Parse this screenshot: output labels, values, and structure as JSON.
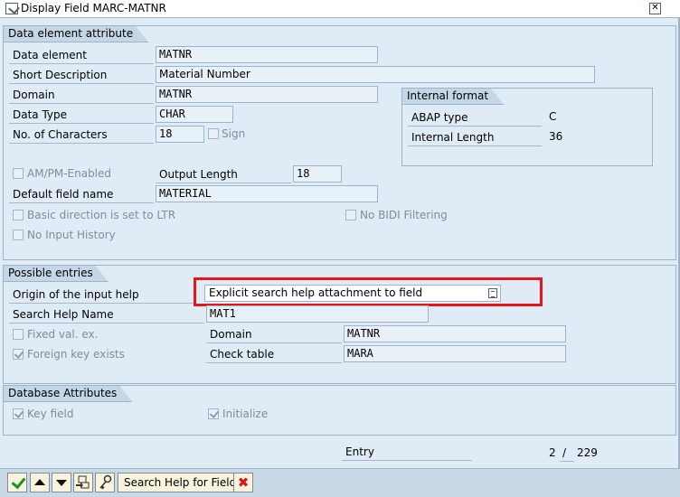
{
  "window": {
    "title": "Display Field MARC-MATNR",
    "close_symbol": "⊠"
  },
  "data_element_group": {
    "title": "Data element attribute",
    "data_element_label": "Data element",
    "data_element_value": "MATNR",
    "short_description_label": "Short Description",
    "short_description_value": "Material Number",
    "domain_label": "Domain",
    "domain_value": "MATNR",
    "data_type_label": "Data Type",
    "data_type_value": "CHAR",
    "no_of_characters_label": "No. of Characters",
    "no_of_characters_value": "18",
    "sign_label": "Sign",
    "sign_checked": false,
    "am_pm_label": "AM/PM-Enabled",
    "am_pm_checked": false,
    "output_length_label": "Output Length",
    "output_length_value": "18",
    "default_field_name_label": "Default field name",
    "default_field_name_value": "MATERIAL",
    "basic_direction_label": "Basic direction is set to LTR",
    "basic_direction_checked": false,
    "no_bidi_label": "No BIDI Filtering",
    "no_bidi_checked": false,
    "no_input_history_label": "No Input History",
    "no_input_history_checked": false
  },
  "internal_format": {
    "title": "Internal format",
    "abap_type_label": "ABAP type",
    "abap_type_value": "C",
    "internal_length_label": "Internal Length",
    "internal_length_value": "36"
  },
  "possible_entries": {
    "title": "Possible entries",
    "origin_label": "Origin of the input help",
    "origin_value": "Explicit search help attachment to field",
    "search_help_name_label": "Search Help Name",
    "search_help_name_value": "MAT1",
    "fixed_val_label": "Fixed val. ex.",
    "fixed_val_checked": false,
    "domain_label": "Domain",
    "domain_value": "MATNR",
    "foreign_key_label": "Foreign key exists",
    "foreign_key_checked": true,
    "check_table_label": "Check table",
    "check_table_value": "MARA"
  },
  "database_attributes": {
    "title": "Database Attributes",
    "key_field_label": "Key field",
    "key_field_checked": true,
    "initialize_label": "Initialize",
    "initialize_checked": true
  },
  "entry": {
    "label": "Entry",
    "current": "2",
    "separator": "/",
    "total": "229"
  },
  "toolbar": {
    "search_help_button_label": "Search Help for Field",
    "cancel_symbol": "✖"
  },
  "colors": {
    "background": "#dfebf5",
    "highlight_border": "#e8141b",
    "ok_green": "#1f8d1f",
    "cancel_red": "#d8141b"
  }
}
